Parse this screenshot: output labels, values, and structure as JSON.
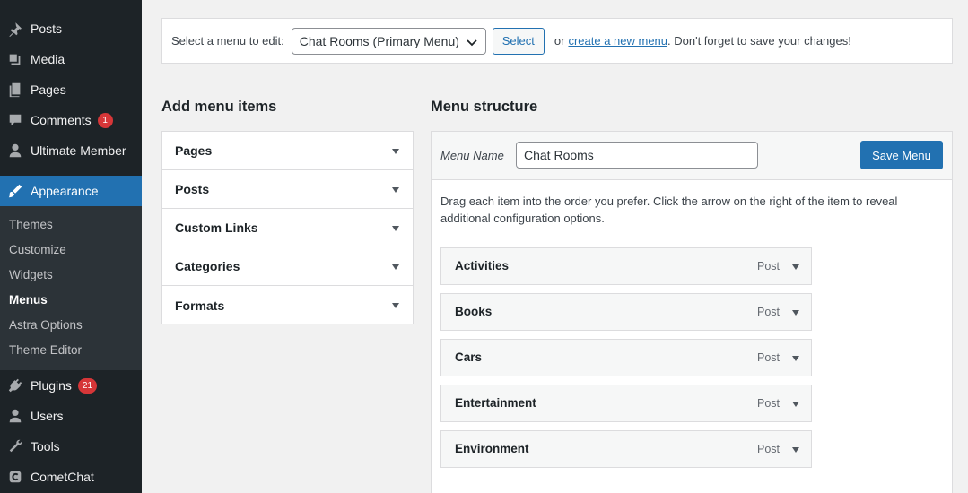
{
  "sidebar": {
    "items": [
      {
        "label": "Posts",
        "icon": "pin-icon"
      },
      {
        "label": "Media",
        "icon": "media-icon"
      },
      {
        "label": "Pages",
        "icon": "pages-icon"
      },
      {
        "label": "Comments",
        "icon": "comment-icon",
        "badge": "1"
      },
      {
        "label": "Ultimate Member",
        "icon": "user-icon"
      },
      {
        "label": "Appearance",
        "icon": "brush-icon"
      },
      {
        "label": "Plugins",
        "icon": "plug-icon",
        "badge": "21"
      },
      {
        "label": "Users",
        "icon": "users-icon"
      },
      {
        "label": "Tools",
        "icon": "wrench-icon"
      },
      {
        "label": "CometChat",
        "icon": "cometchat-icon"
      }
    ],
    "submenu": [
      "Themes",
      "Customize",
      "Widgets",
      "Menus",
      "Astra Options",
      "Theme Editor"
    ],
    "current_submenu": "Menus"
  },
  "topbar": {
    "prompt": "Select a menu to edit:",
    "selected_menu": "Chat Rooms (Primary Menu)",
    "select_button": "Select",
    "or_text": "or",
    "create_link": "create a new menu",
    "reminder": ". Don't forget to save your changes!"
  },
  "add_items": {
    "heading": "Add menu items",
    "sections": [
      "Pages",
      "Posts",
      "Custom Links",
      "Categories",
      "Formats"
    ]
  },
  "structure": {
    "heading": "Menu structure",
    "name_label": "Menu Name",
    "name_value": "Chat Rooms",
    "save_button": "Save Menu",
    "instructions": "Drag each item into the order you prefer. Click the arrow on the right of the item to reveal additional configuration options.",
    "items": [
      {
        "title": "Activities",
        "type": "Post"
      },
      {
        "title": "Books",
        "type": "Post"
      },
      {
        "title": "Cars",
        "type": "Post"
      },
      {
        "title": "Entertainment",
        "type": "Post"
      },
      {
        "title": "Environment",
        "type": "Post"
      }
    ]
  },
  "colors": {
    "accent": "#2271b1",
    "sidebar": "#1d2327",
    "badge": "#d63638"
  }
}
